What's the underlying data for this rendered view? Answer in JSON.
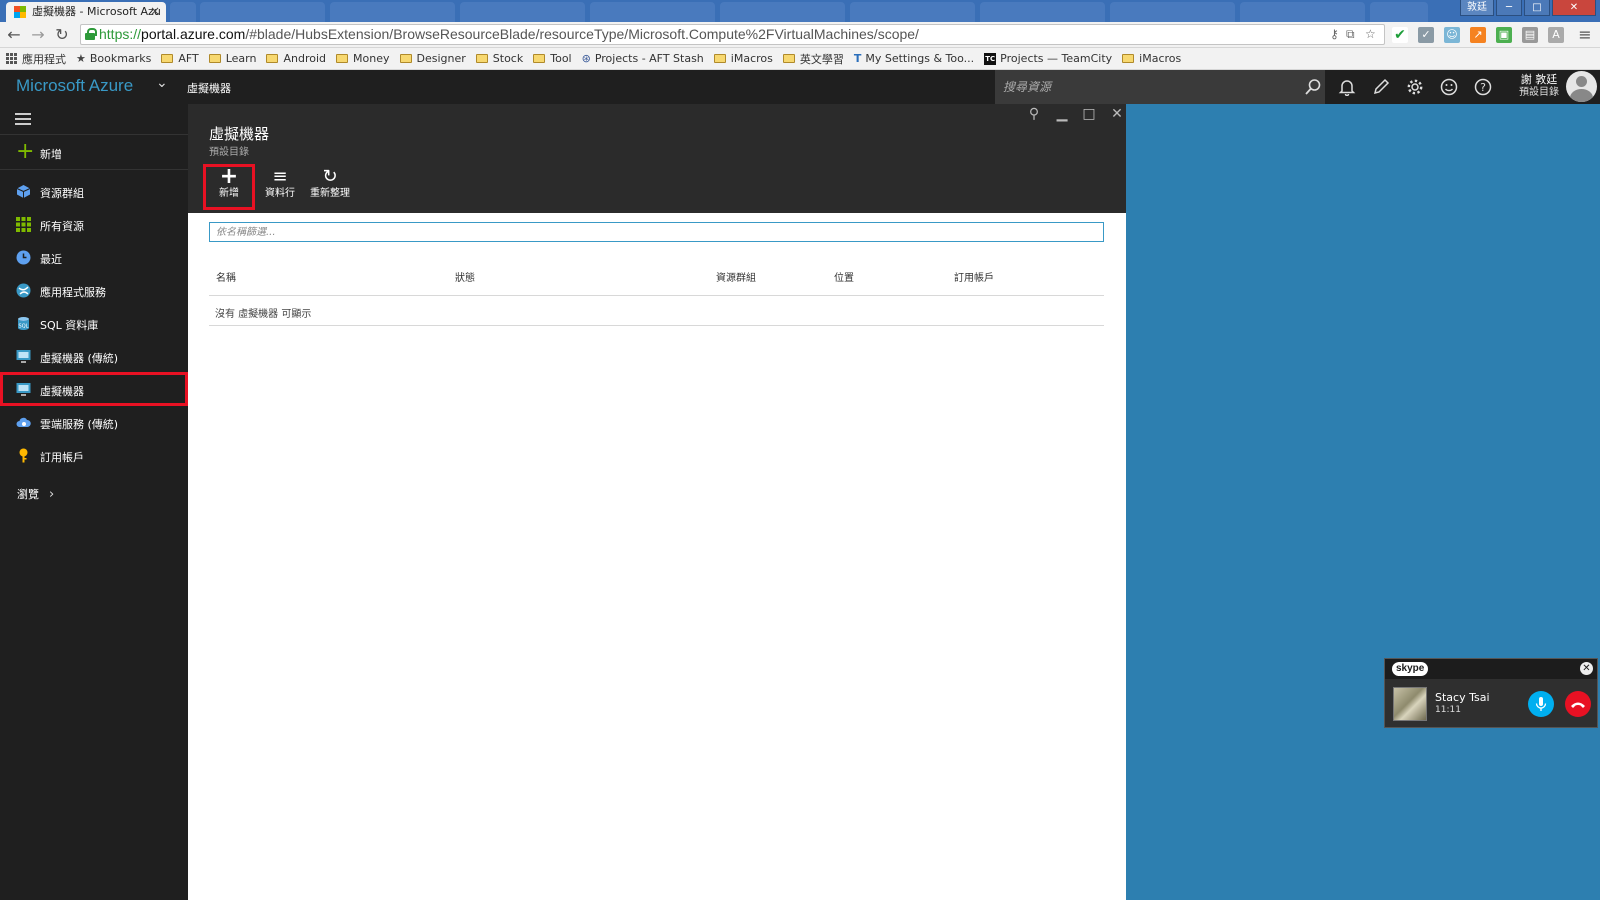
{
  "browser": {
    "active_tab_title": "虛擬機器 - Microsoft Azu",
    "tab_close": "×",
    "window_user": "敦廷",
    "window_minimize": "─",
    "window_maximize": "□",
    "window_close": "✕",
    "url_protocol": "https://",
    "url_host": "portal.azure.com",
    "url_path": "/#blade/HubsExtension/BrowseResourceBlade/resourceType/Microsoft.Compute%2FVirtualMachines/scope/",
    "back": "←",
    "forward": "→",
    "reload": "↻",
    "menu": "≡"
  },
  "bookmarks": [
    {
      "label": "應用程式",
      "icon": "apps-icon"
    },
    {
      "label": "Bookmarks",
      "icon": "star-icon"
    },
    {
      "label": "AFT",
      "icon": "folder-icon"
    },
    {
      "label": "Learn",
      "icon": "folder-icon"
    },
    {
      "label": "Android",
      "icon": "folder-icon"
    },
    {
      "label": "Money",
      "icon": "folder-icon"
    },
    {
      "label": "Designer",
      "icon": "folder-icon"
    },
    {
      "label": "Stock",
      "icon": "folder-icon"
    },
    {
      "label": "Tool",
      "icon": "folder-icon"
    },
    {
      "label": "Projects - AFT Stash",
      "icon": "stash-icon"
    },
    {
      "label": "iMacros",
      "icon": "folder-icon"
    },
    {
      "label": "英文學習",
      "icon": "folder-icon"
    },
    {
      "label": "My Settings & Too...",
      "icon": "trello-icon"
    },
    {
      "label": "Projects — TeamCity",
      "icon": "teamcity-icon"
    },
    {
      "label": "iMacros",
      "icon": "folder-icon"
    }
  ],
  "azure": {
    "brand": "Microsoft Azure",
    "brand_chevron": "⌄",
    "breadcrumb": "虛擬機器",
    "search_placeholder": "搜尋資源",
    "account_name": "謝 敦廷",
    "account_directory": "預設目錄"
  },
  "sidebar": {
    "new_label": "新增",
    "items": [
      {
        "label": "資源群組",
        "icon": "resource-group-icon"
      },
      {
        "label": "所有資源",
        "icon": "all-resources-icon"
      },
      {
        "label": "最近",
        "icon": "clock-icon"
      },
      {
        "label": "應用程式服務",
        "icon": "app-service-icon"
      },
      {
        "label": "SQL 資料庫",
        "icon": "sql-database-icon"
      },
      {
        "label": "虛擬機器 (傳統)",
        "icon": "vm-classic-icon"
      },
      {
        "label": "虛擬機器",
        "icon": "vm-icon",
        "selected": true
      },
      {
        "label": "雲端服務 (傳統)",
        "icon": "cloud-service-icon"
      },
      {
        "label": "訂用帳戶",
        "icon": "key-icon"
      }
    ],
    "browse_label": "瀏覽",
    "browse_chevron": "›"
  },
  "blade": {
    "title": "虛擬機器",
    "subtitle": "預設目錄",
    "commands": [
      {
        "label": "新增",
        "glyph": "+",
        "highlighted": true
      },
      {
        "label": "資料行",
        "glyph": "≡"
      },
      {
        "label": "重新整理",
        "glyph": "↻"
      }
    ],
    "filter_placeholder": "依名稱篩選...",
    "columns": [
      "名稱",
      "狀態",
      "資源群組",
      "位置",
      "訂用帳戶"
    ],
    "empty_message": "沒有 虛擬機器 可顯示",
    "pin": "⚲",
    "minimize": "▁",
    "maximize": "□",
    "close": "✕"
  },
  "skype": {
    "logo": "skype",
    "close": "✕",
    "caller": "Stacy Tsai",
    "duration": "11:11"
  },
  "colors": {
    "azure_blue": "#3999c6",
    "highlight_red": "#e81123",
    "dashboard_bg": "#2d7fb0",
    "portal_dark": "#1f1f1f"
  }
}
